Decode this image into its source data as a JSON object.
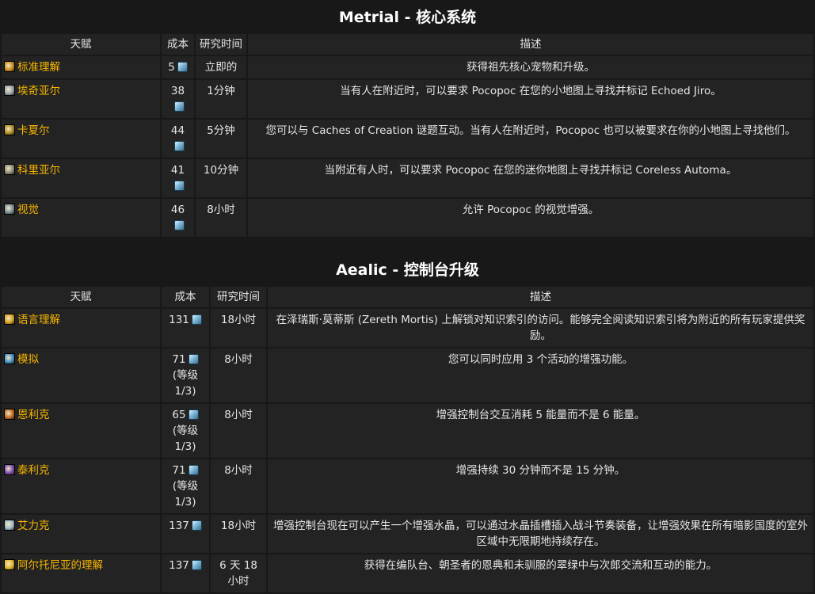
{
  "sections": [
    {
      "title": "Metrial - 核心系统",
      "headers": [
        "天赋",
        "成本",
        "研究时间",
        "描述"
      ],
      "rows": [
        {
          "name": "标准理解",
          "icon": "flame-icon",
          "icon_color": "#c98b1e",
          "cost": "5",
          "time": "立即的",
          "desc": "获得祖先核心宠物和升级。"
        },
        {
          "name": "埃奇亚尔",
          "icon": "lightning-scroll-icon",
          "icon_color": "#9aa4b1",
          "cost": "38",
          "time": "1分钟",
          "desc": "当有人在附近时，可以要求 Pocopoc 在您的小地图上寻找并标记 Echoed Jiro。"
        },
        {
          "name": "卡夏尔",
          "icon": "crossed-blades-icon",
          "icon_color": "#b08d22",
          "cost": "44",
          "time": "5分钟",
          "desc": "您可以与 Caches of Creation 谜题互动。当有人在附近时，Pocopoc 也可以被要求在你的小地图上寻找他们。"
        },
        {
          "name": "科里亚尔",
          "icon": "gear-cube-icon",
          "icon_color": "#8a8a7a",
          "cost": "41",
          "time": "10分钟",
          "desc": "当附近有人时，可以要求 Pocopoc 在您的迷你地图上寻找并标记 Coreless Automa。"
        },
        {
          "name": "视觉",
          "icon": "eye-orb-icon",
          "icon_color": "#7b8f9a",
          "cost": "46",
          "time": "8小时",
          "desc": "允许 Pocopoc 的视觉增强。"
        }
      ]
    },
    {
      "title": "Aealic - 控制台升级",
      "headers": [
        "天赋",
        "成本",
        "研究时间",
        "描述"
      ],
      "rows": [
        {
          "name": "语言理解",
          "icon": "golden-star-icon",
          "icon_color": "#d4a21c",
          "cost": "131",
          "cost_sub": "",
          "time": "18小时",
          "desc": "在泽瑞斯·莫蒂斯 (Zereth Mortis) 上解锁对知识索引的访问。能够完全阅读知识索引将为附近的所有玩家提供奖励。"
        },
        {
          "name": "模拟",
          "icon": "blue-crystal-icon",
          "icon_color": "#3f8fc7",
          "cost": "71",
          "cost_sub": "(等级 1/3)",
          "time": "8小时",
          "desc": "您可以同时应用 3 个活动的增强功能。"
        },
        {
          "name": "恩利克",
          "icon": "orange-rune-icon",
          "icon_color": "#c46a24",
          "cost": "65",
          "cost_sub": "(等级 1/3)",
          "time": "8小时",
          "desc": "增强控制台交互消耗 5 能量而不是 6 能量。"
        },
        {
          "name": "泰利克",
          "icon": "purple-figure-icon",
          "icon_color": "#7c4bb0",
          "cost": "71",
          "cost_sub": "(等级 1/3)",
          "time": "8小时",
          "desc": "增强持续 30 分钟而不是 15 分钟。"
        },
        {
          "name": "艾力克",
          "icon": "crystal-shard-icon",
          "icon_color": "#9fb8c8",
          "cost": "137",
          "cost_sub": "",
          "time": "18小时",
          "desc": "增强控制台现在可以产生一个增强水晶，可以通过水晶插槽插入战斗节奏装备，让增强效果在所有暗影国度的室外区域中无限期地持续存在。"
        },
        {
          "name": "阿尔托尼亚的理解",
          "icon": "gold-diamond-icon",
          "icon_color": "#e0b52a",
          "cost": "137",
          "cost_sub": "",
          "time": "6 天 18 小时",
          "desc": "获得在编队台、朝圣者的恩典和未驯服的翠绿中与次郎交流和互动的能力。"
        }
      ]
    }
  ],
  "currency_icon": "cosmic-flux-gem-icon"
}
